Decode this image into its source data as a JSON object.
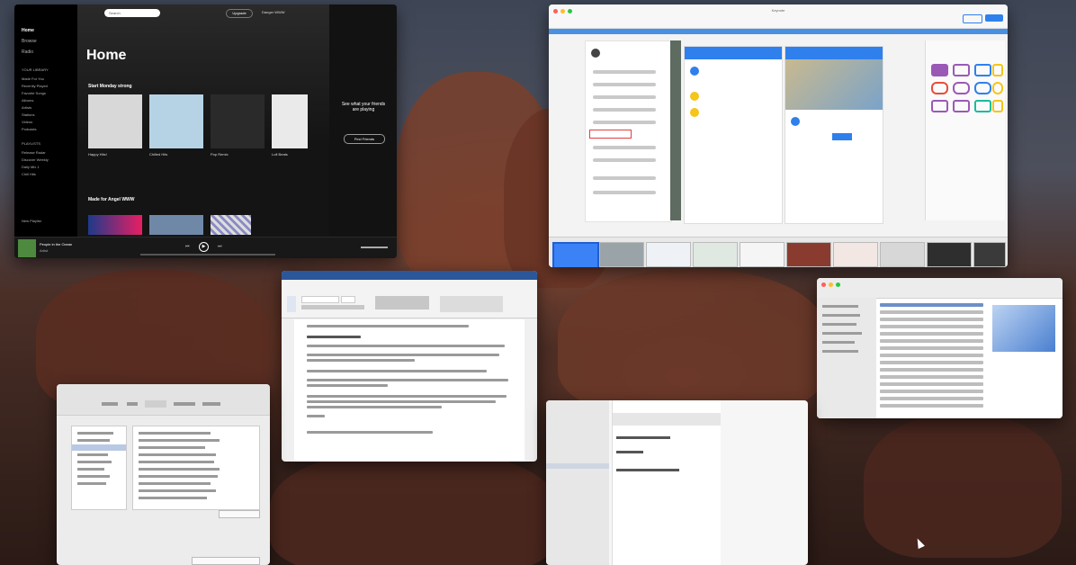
{
  "spotify": {
    "search_placeholder": "Search",
    "upgrade_label": "Upgrade",
    "user_name": "Danger WWW",
    "nav": [
      "Home",
      "Browse",
      "Radio"
    ],
    "library_header": "YOUR LIBRARY",
    "library": [
      "Made For You",
      "Recently Played",
      "Favorite Songs",
      "Albums",
      "Artists",
      "Stations",
      "Videos",
      "Podcasts"
    ],
    "playlists_header": "PLAYLISTS",
    "playlists": [
      "Release Radar",
      "Discover Weekly",
      "Daily Mix 1",
      "Chill Hits"
    ],
    "new_playlist": "New Playlist",
    "page_title": "Home",
    "section_1": "Start Monday strong",
    "section_2": "Made for Angel WWW",
    "cards": [
      "Happy Hits!",
      "Chilled Hits",
      "Pop Remix",
      "Lofi Beats"
    ],
    "friends_heading": "See what your friends are playing",
    "friends_button": "Find Friends",
    "now_playing_title": "People in the Ocean",
    "now_playing_artist": "Artist"
  },
  "keynote": {
    "window_title": "Keynote"
  },
  "word": {
    "doc_heading": "Keyboard Shortcuts"
  },
  "colors": {
    "spotify_green": "#1db954",
    "accent_blue": "#2f80ed",
    "word_blue": "#2b579a"
  }
}
